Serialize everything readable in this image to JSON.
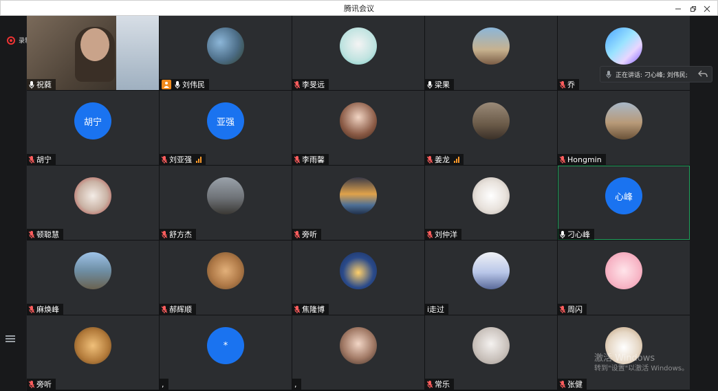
{
  "window": {
    "title": "腾讯会议"
  },
  "recording": {
    "label": "录制中"
  },
  "speaking": {
    "text": "正在讲话: 刁心峰; 刘伟民;"
  },
  "participants": [
    {
      "name": "祝蕤",
      "avatar_type": "video",
      "mic": "on"
    },
    {
      "name": "刘伟民",
      "avatar_type": "photo-palm",
      "mic": "on",
      "host": true
    },
    {
      "name": "李旻远",
      "avatar_type": "photo-anime",
      "mic": "muted"
    },
    {
      "name": "梁果",
      "avatar_type": "photo-people",
      "mic": "on"
    },
    {
      "name": "乔",
      "avatar_type": "photo-abstract",
      "mic": "muted"
    },
    {
      "name": "胡宁",
      "avatar_type": "initials",
      "initials": "胡宁",
      "mic": "muted"
    },
    {
      "name": "刘亚强",
      "avatar_type": "initials",
      "initials": "亚强",
      "mic": "muted",
      "signal": true
    },
    {
      "name": "李雨馨",
      "avatar_type": "photo-portrait",
      "mic": "muted"
    },
    {
      "name": "姜龙",
      "avatar_type": "photo-family",
      "mic": "muted",
      "signal": true
    },
    {
      "name": "Hongmin",
      "avatar_type": "photo-city",
      "mic": "muted"
    },
    {
      "name": "顿聪慧",
      "avatar_type": "photo-anime2",
      "mic": "muted"
    },
    {
      "name": "舒方杰",
      "avatar_type": "photo-beach",
      "mic": "muted"
    },
    {
      "name": "旁听",
      "avatar_type": "photo-sunset",
      "mic": "muted"
    },
    {
      "name": "刘仲洋",
      "avatar_type": "photo-cat",
      "mic": "muted"
    },
    {
      "name": "刁心峰",
      "avatar_type": "initials",
      "initials": "心峰",
      "mic": "on",
      "active": true
    },
    {
      "name": "麻焕峰",
      "avatar_type": "photo-street",
      "mic": "muted"
    },
    {
      "name": "郝辉顺",
      "avatar_type": "photo-dog",
      "mic": "muted"
    },
    {
      "name": "焦隆博",
      "avatar_type": "photo-anime3",
      "mic": "muted"
    },
    {
      "name": "i走过",
      "avatar_type": "photo-boy",
      "mic": "none"
    },
    {
      "name": "周闪",
      "avatar_type": "photo-pink",
      "mic": "muted"
    },
    {
      "name": "旁听",
      "avatar_type": "photo-doge",
      "mic": "muted"
    },
    {
      "name": ",",
      "avatar_type": "initials",
      "initials": "*",
      "mic": "none"
    },
    {
      "name": ",",
      "avatar_type": "photo-portrait2",
      "mic": "none"
    },
    {
      "name": "常乐",
      "avatar_type": "photo-girl",
      "mic": "muted"
    },
    {
      "name": "张健",
      "avatar_type": "photo-meerkat",
      "mic": "muted"
    }
  ],
  "watermark": {
    "line1": "激活 Windows",
    "line2": "转到\"设置\"以激活 Windows。"
  }
}
